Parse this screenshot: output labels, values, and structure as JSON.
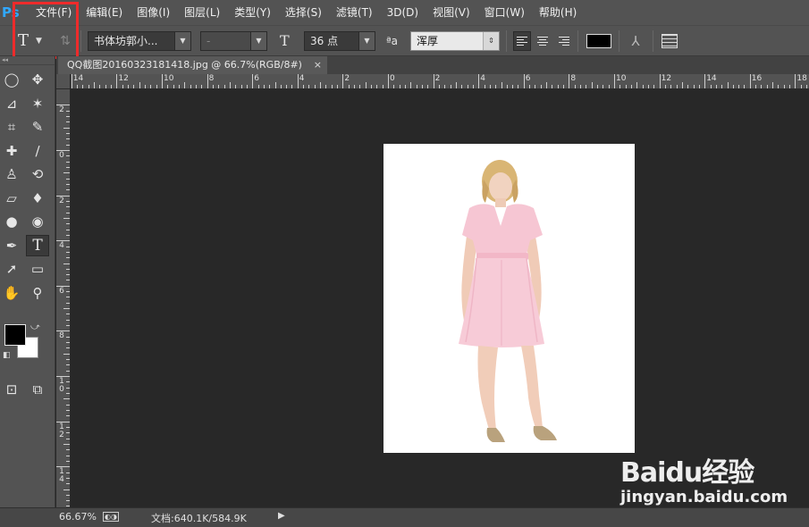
{
  "app": {
    "logo": "Ps"
  },
  "menu": [
    "文件(F)",
    "编辑(E)",
    "图像(I)",
    "图层(L)",
    "类型(Y)",
    "选择(S)",
    "滤镜(T)",
    "3D(D)",
    "视图(V)",
    "窗口(W)",
    "帮助(H)"
  ],
  "options": {
    "tool_icon": "T",
    "font_family": "书体坊郭小...",
    "font_style": "-",
    "size_icon": "T",
    "font_size": "36 点",
    "aa_icon": "ªa",
    "antialias": "浑厚",
    "text_color": "#000000"
  },
  "highlight_color": "#ee2b2b",
  "tools": [
    {
      "name": "elliptical-marquee-icon",
      "glyph": "◯"
    },
    {
      "name": "move-icon",
      "glyph": "✥"
    },
    {
      "name": "polygonal-lasso-icon",
      "glyph": "⊿"
    },
    {
      "name": "magic-wand-icon",
      "glyph": "✶"
    },
    {
      "name": "crop-icon",
      "glyph": "⌗"
    },
    {
      "name": "eyedropper-icon",
      "glyph": "✎"
    },
    {
      "name": "healing-brush-icon",
      "glyph": "✚"
    },
    {
      "name": "brush-icon",
      "glyph": "∕"
    },
    {
      "name": "clone-stamp-icon",
      "glyph": "♙"
    },
    {
      "name": "history-brush-icon",
      "glyph": "⟲"
    },
    {
      "name": "eraser-icon",
      "glyph": "▱"
    },
    {
      "name": "paint-bucket-icon",
      "glyph": "♦"
    },
    {
      "name": "blur-icon",
      "glyph": "●"
    },
    {
      "name": "dodge-icon",
      "glyph": "◉"
    },
    {
      "name": "pen-icon",
      "glyph": "✒"
    },
    {
      "name": "type-icon",
      "glyph": "T"
    },
    {
      "name": "path-selection-icon",
      "glyph": "➚"
    },
    {
      "name": "rectangle-icon",
      "glyph": "▭"
    },
    {
      "name": "hand-icon",
      "glyph": "✋"
    },
    {
      "name": "zoom-icon",
      "glyph": "⚲"
    },
    {
      "name": "quick-mask-icon",
      "glyph": "⊡"
    },
    {
      "name": "screen-mode-icon",
      "glyph": "⧉"
    }
  ],
  "doc_tab": {
    "title": "QQ截图20160323181418.jpg @ 66.7%(RGB/8#)",
    "close": "×"
  },
  "ruler_h": [
    "14",
    "12",
    "10",
    "8",
    "6",
    "4",
    "2",
    "0",
    "2",
    "4",
    "6",
    "8",
    "10",
    "12",
    "14",
    "16",
    "18"
  ],
  "ruler_v": [
    "2",
    "0",
    "2",
    "4",
    "6",
    "8",
    "1\n0",
    "1\n2",
    "1\n4"
  ],
  "status": {
    "zoom": "66.67%",
    "doc_info": "文档:640.1K/584.9K",
    "arrow": "▶"
  },
  "watermark": {
    "logo": "Baidu经验",
    "url": "jingyan.baidu.com"
  }
}
